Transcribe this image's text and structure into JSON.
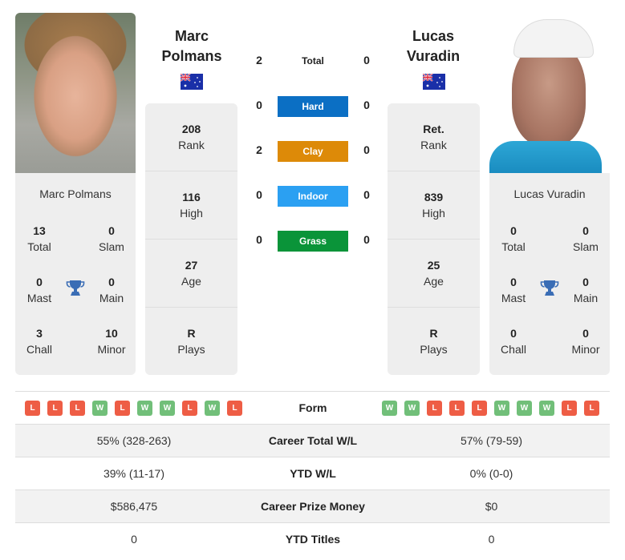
{
  "player1": {
    "name_line1": "Marc",
    "name_line2": "Polmans",
    "full_name": "Marc Polmans",
    "country_flag": "australia-flag",
    "titles": {
      "total": {
        "value": "13",
        "label": "Total"
      },
      "slam": {
        "value": "0",
        "label": "Slam"
      },
      "mast": {
        "value": "0",
        "label": "Mast"
      },
      "main": {
        "value": "0",
        "label": "Main"
      },
      "chall": {
        "value": "3",
        "label": "Chall"
      },
      "minor": {
        "value": "10",
        "label": "Minor"
      }
    },
    "stats": [
      {
        "value": "208",
        "label": "Rank"
      },
      {
        "value": "116",
        "label": "High"
      },
      {
        "value": "27",
        "label": "Age"
      },
      {
        "value": "R",
        "label": "Plays"
      }
    ],
    "form": [
      "L",
      "L",
      "L",
      "W",
      "L",
      "W",
      "W",
      "L",
      "W",
      "L"
    ]
  },
  "player2": {
    "name_line1": "Lucas",
    "name_line2": "Vuradin",
    "full_name": "Lucas Vuradin",
    "country_flag": "australia-flag",
    "titles": {
      "total": {
        "value": "0",
        "label": "Total"
      },
      "slam": {
        "value": "0",
        "label": "Slam"
      },
      "mast": {
        "value": "0",
        "label": "Mast"
      },
      "main": {
        "value": "0",
        "label": "Main"
      },
      "chall": {
        "value": "0",
        "label": "Chall"
      },
      "minor": {
        "value": "0",
        "label": "Minor"
      }
    },
    "stats": [
      {
        "value": "Ret.",
        "label": "Rank"
      },
      {
        "value": "839",
        "label": "High"
      },
      {
        "value": "25",
        "label": "Age"
      },
      {
        "value": "R",
        "label": "Plays"
      }
    ],
    "form": [
      "W",
      "W",
      "L",
      "L",
      "L",
      "W",
      "W",
      "W",
      "L",
      "L"
    ]
  },
  "h2h": {
    "total": {
      "label": "Total",
      "p1": "2",
      "p2": "0"
    },
    "surfaces": [
      {
        "label": "Hard",
        "p1": "0",
        "p2": "0",
        "color": "#0b6fc4"
      },
      {
        "label": "Clay",
        "p1": "2",
        "p2": "0",
        "color": "#dd8a08"
      },
      {
        "label": "Indoor",
        "p1": "0",
        "p2": "0",
        "color": "#2ba0f2"
      },
      {
        "label": "Grass",
        "p1": "0",
        "p2": "0",
        "color": "#0a9439"
      }
    ]
  },
  "table": {
    "form_label": "Form",
    "rows": [
      {
        "label": "Career Total W/L",
        "p1": "55% (328-263)",
        "p2": "57% (79-59)"
      },
      {
        "label": "YTD W/L",
        "p1": "39% (11-17)",
        "p2": "0% (0-0)"
      },
      {
        "label": "Career Prize Money",
        "p1": "$586,475",
        "p2": "$0"
      },
      {
        "label": "YTD Titles",
        "p1": "0",
        "p2": "0"
      }
    ]
  },
  "colors": {
    "win": "#71bf79",
    "loss": "#ee5d45",
    "trophy": "#3a6db5"
  }
}
